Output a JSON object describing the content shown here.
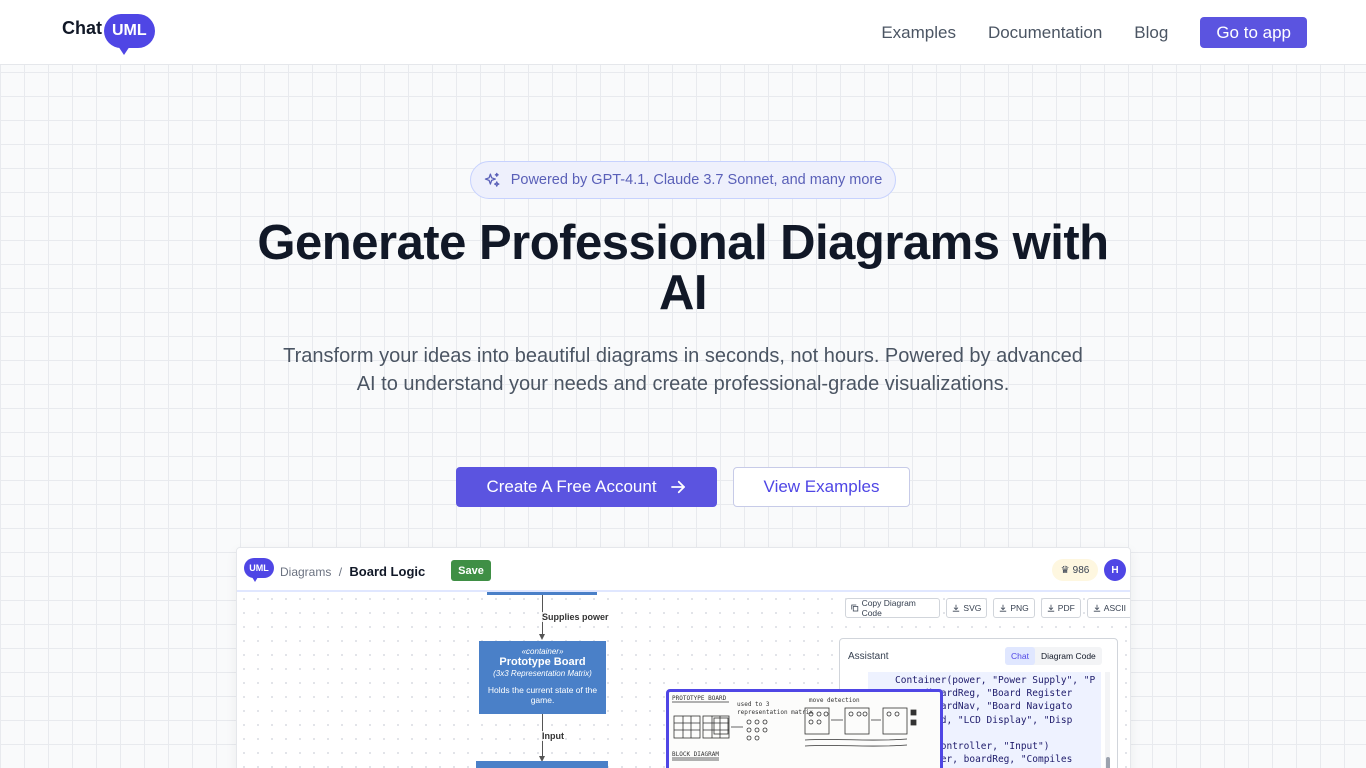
{
  "header": {
    "logo_text": "Chat",
    "logo_badge": "UML",
    "nav": [
      {
        "label": "Examples"
      },
      {
        "label": "Documentation"
      },
      {
        "label": "Blog"
      }
    ],
    "cta": "Go to app"
  },
  "hero": {
    "badge": "Powered by GPT-4.1, Claude 3.7 Sonnet, and many more",
    "title_line1": "Generate Professional Diagrams with",
    "title_line2": "AI",
    "subtitle": "Transform your ideas into beautiful diagrams in seconds, not hours. Powered by advanced AI to understand your needs and create professional-grade visualizations.",
    "primary_button": "Create A Free Account",
    "secondary_button": "View Examples"
  },
  "preview": {
    "logo_badge": "UML",
    "breadcrumb_root": "Diagrams",
    "breadcrumb_sep": "/",
    "breadcrumb_current": "Board Logic",
    "save_label": "Save",
    "credits": "986",
    "avatar": "H",
    "toolbar": [
      {
        "label": "Copy Diagram Code"
      },
      {
        "label": "SVG"
      },
      {
        "label": "PNG"
      },
      {
        "label": "PDF"
      },
      {
        "label": "ASCII"
      }
    ],
    "diagram": {
      "edge1_label": "Supplies power",
      "node_stereotype": "«container»",
      "node_title": "Prototype Board",
      "node_subtitle": "(3x3 Representation Matrix)",
      "node_desc": "Holds the current state of the game.",
      "edge2_label": "Input"
    },
    "sketch": {
      "label1": "PROTOTYPE BOARD",
      "label2": "BLOCK DIAGRAM",
      "note1": "move detection",
      "note2": "used to 3",
      "note3": "representation matrix"
    },
    "assistant": {
      "title": "Assistant",
      "tab_chat": "Chat",
      "tab_code": "Diagram Code",
      "code_lines": [
        "Container(power, \"Power Supply\", \"P",
        "     (boardReg, \"Board Register",
        "     (boardNav, \"Board Navigato",
        "     (lcd, \"LCD Display\", \"Disp",
        "",
        "     , controller, \"Input\")",
        "     oller, boardReg, \"Compiles"
      ]
    }
  },
  "colors": {
    "accent": "#5b54e0",
    "node_blue": "#4a80c8",
    "save_green": "#3f8f45"
  }
}
